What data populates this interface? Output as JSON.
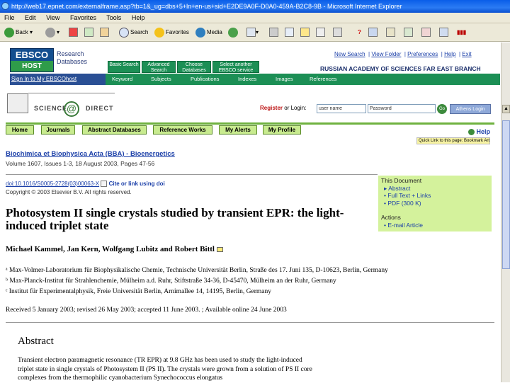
{
  "window": {
    "title": "http://web17.epnet.com/externalframe.asp?tb=1&_ug=dbs+5+ln+en-us+sid+E2DE9A0F-D0A0-459A-B2C8-9B - Microsoft Internet Explorer"
  },
  "menu": [
    "File",
    "Edit",
    "View",
    "Favorites",
    "Tools",
    "Help"
  ],
  "toolbar": {
    "back": "Back",
    "search": "Search",
    "favorites": "Favorites",
    "media": "Media"
  },
  "ebsco": {
    "logo_top": "EBSCO",
    "logo_bottom": "HOST",
    "subtitle": "Research Databases",
    "tabs": [
      "Basic Search",
      "Advanced Search",
      "Choose Databases",
      "Select another EBSCO service"
    ],
    "signin": "Sign In to My EBSCOhost",
    "bar_links": [
      "Keyword",
      "Subjects",
      "Publications",
      "Indexes",
      "Images",
      "References"
    ],
    "top_links": [
      "New Search",
      "View Folder",
      "Preferences",
      "Help",
      "Exit"
    ],
    "institution": "RUSSIAN ACADEMY OF SCIENCES FAR EAST BRANCH"
  },
  "sd": {
    "logo_text": "SCIENCE",
    "logo_text2": "DIRECT",
    "register": "Register",
    "or_login": "or Login:",
    "username_placeholder": "user name",
    "password_placeholder": "Password",
    "go": "Go",
    "athens": "Athens Login",
    "tabs": [
      "Home",
      "Journals",
      "Abstract Databases",
      "Reference Works",
      "My Alerts",
      "My Profile"
    ],
    "help": "Help",
    "bookmark": "Quick Link to this page: Bookmark Article Info"
  },
  "article": {
    "journal": "Biochimica et Biophysica Acta (BBA) - Bioenergetics",
    "volume": "Volume 1607, Issues 1-3, 18 August 2003, Pages 47-56",
    "doi": "doi:10.1016/S0005-2728(03)00063-X",
    "cite": "Cite or link using doi",
    "copyright": "Copyright © 2003 Elsevier B.V. All rights reserved.",
    "title": "Photosystem II single crystals studied by transient EPR: the light-induced triplet state",
    "authors": "Michael Kammel, Jan Kern, Wolfgang Lubitz and Robert Bittl",
    "affiliations": [
      "ᵃ Max-Volmer-Laboratorium für Biophysikalische Chemie, Technische Universität Berlin, Straße des 17. Juni 135, D-10623, Berlin, Germany",
      "ᵇ Max-Planck-Institut für Strahlenchemie, Mülheim a.d. Ruhr, Stiftstraße 34-36, D-45470, Mülheim an der Ruhr, Germany",
      "ᶜ Institut für Experimentalphysik, Freie Universität Berlin, Arnimallee 14, 14195, Berlin, Germany"
    ],
    "dates": "Received 5 January 2003;  revised 26 May 2003;  accepted 11 June 2003. ; Available online 24 June 2003",
    "abstract_heading": "Abstract",
    "abstract_text": "Transient electron paramagnetic resonance (TR EPR) at 9.8 GHz has been used to study the light-induced triplet state in single crystals of Photosystem II (PS II). The crystals were grown from a solution of PS II core complexes from the thermophilic cyanobacterium Synechococcus elongatus"
  },
  "sidebox": {
    "heading1": "This Document",
    "items1": [
      "▸ Abstract",
      "• Full Text + Links",
      "• PDF (300 K)"
    ],
    "heading2": "Actions",
    "items2": [
      "• E-mail Article"
    ]
  }
}
